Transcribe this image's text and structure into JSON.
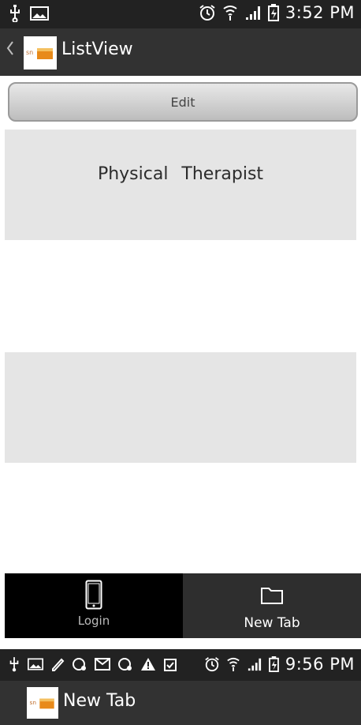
{
  "screen1": {
    "status_bar": {
      "time": "3:52 PM",
      "icons": [
        "usb-icon",
        "image-icon",
        "alarm-icon",
        "wifi-icon",
        "signal-icon",
        "battery-icon"
      ]
    },
    "action_bar": {
      "title": "ListView",
      "back_icon": "chevron-left-icon",
      "logo_icon": "app-logo-icon"
    },
    "edit_button": {
      "label": "Edit"
    },
    "list_items": [
      {
        "label": "Physical   Therapist"
      },
      {
        "label": ""
      }
    ],
    "tabs": [
      {
        "label": "Login",
        "icon": "phone-icon",
        "selected": true
      },
      {
        "label": "New Tab",
        "icon": "folder-icon",
        "selected": false
      }
    ]
  },
  "screen2": {
    "status_bar": {
      "time": "9:56 PM",
      "icons": [
        "usb-icon",
        "image-icon",
        "pen-icon",
        "sync-icon",
        "mail-icon",
        "sync-icon",
        "warning-icon",
        "clipboard-icon",
        "alarm-icon",
        "wifi-icon",
        "signal-icon",
        "battery-icon"
      ]
    },
    "action_bar": {
      "title": "New Tab",
      "logo_icon": "app-logo-icon"
    }
  },
  "colors": {
    "status_bar": "#222222",
    "action_bar": "#323232",
    "list_row": "#e5e5e5",
    "tab_selected": "#000000",
    "tab_unselected": "#2e2e2e"
  }
}
